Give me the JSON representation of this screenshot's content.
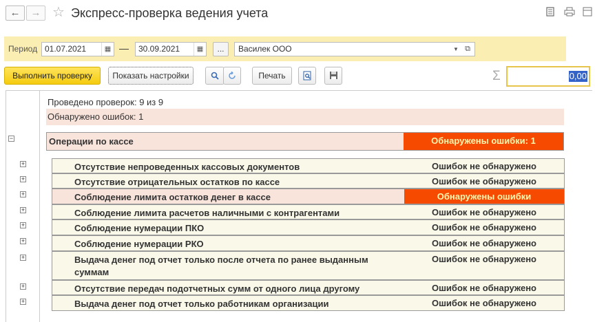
{
  "window": {
    "title": "Экспресс-проверка ведения учета",
    "back_icon": "←",
    "forward_icon": "→",
    "star_icon": "☆"
  },
  "filter": {
    "period_label": "Период",
    "date_from": "01.07.2021",
    "date_to": "30.09.2021",
    "dash": "—",
    "dots": "...",
    "organization": "Василек ООО"
  },
  "toolbar": {
    "run_label": "Выполнить проверку",
    "settings_label": "Показать настройки",
    "print_label": "Печать",
    "sigma": "Σ",
    "sum_value": "0,00"
  },
  "report": {
    "checks_done": "Проведено проверок: 9 из 9",
    "errors_found": "Обнаружено ошибок: 1",
    "group": {
      "name": "Операции по кассе",
      "status": "Обнаружены ошибки: 1"
    },
    "rows": [
      {
        "name": "Отсутствие непроведенных кассовых документов",
        "status": "Ошибок не обнаружено"
      },
      {
        "name": "Отсутствие отрицательных остатков по кассе",
        "status": "Ошибок не обнаружено"
      },
      {
        "name": "Соблюдение лимита остатков денег в кассе",
        "status": "Обнаружены ошибки"
      },
      {
        "name": "Соблюдение лимита расчетов наличными с контрагентами",
        "status": "Ошибок не обнаружено"
      },
      {
        "name": "Соблюдение нумерации ПКО",
        "status": "Ошибок не обнаружено"
      },
      {
        "name": "Соблюдение нумерации РКО",
        "status": "Ошибок не обнаружено"
      },
      {
        "name": "Выдача денег под отчет только после отчета по ранее выданным суммам",
        "status": "Ошибок не обнаружено"
      },
      {
        "name": "Отсутствие передач подотчетных сумм от одного лица другому",
        "status": "Ошибок не обнаружено"
      },
      {
        "name": "Выдача денег под отчет только работникам организации",
        "status": "Ошибок не обнаружено"
      }
    ]
  },
  "colors": {
    "accent_yellow": "#f5cc10",
    "error_orange": "#f54a00",
    "error_bg": "#f9e4dc",
    "row_bg": "#faf8e9"
  }
}
